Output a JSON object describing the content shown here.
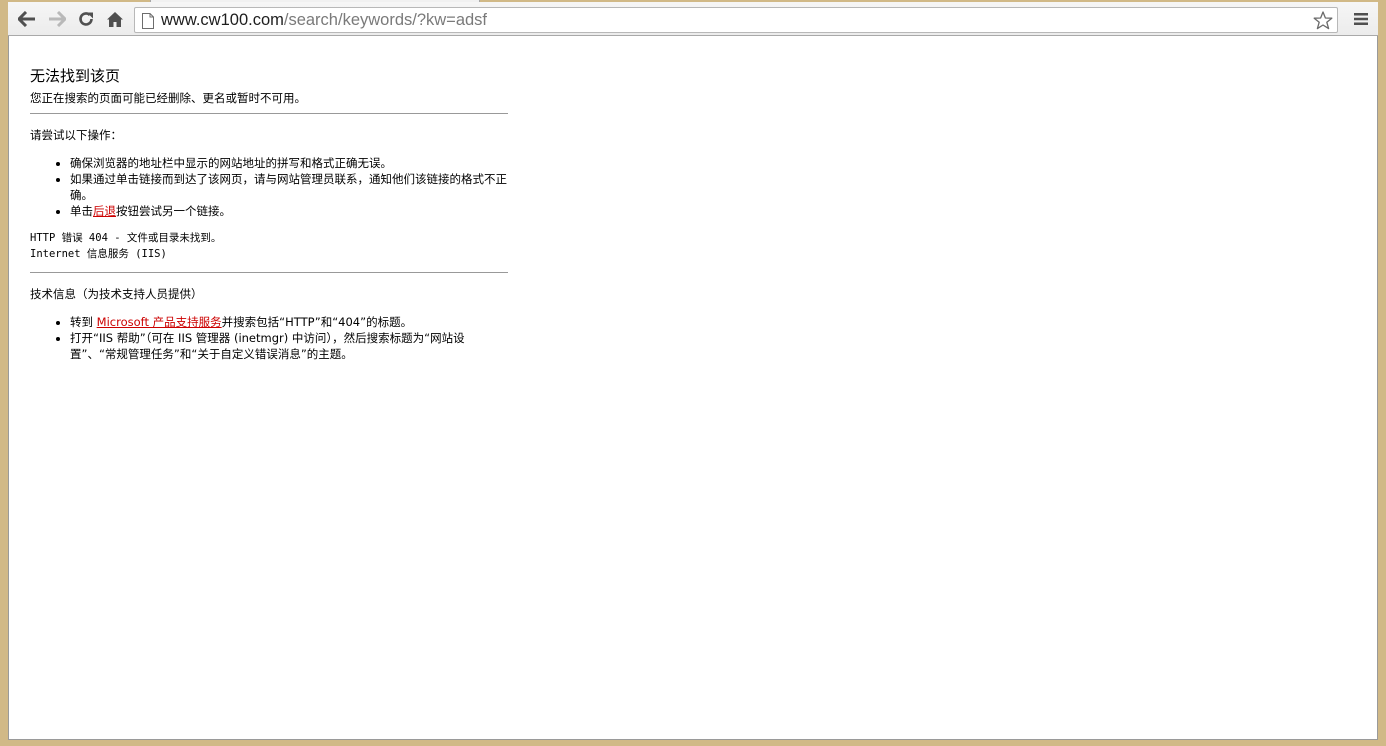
{
  "browser": {
    "url_host": "www.cw100.com",
    "url_path": "/search/keywords/?kw=adsf",
    "icons": {
      "back": "back-arrow-icon",
      "forward": "forward-arrow-icon",
      "reload": "reload-icon",
      "home": "home-icon",
      "page": "page-icon",
      "star": "star-icon",
      "menu": "hamburger-menu-icon"
    }
  },
  "error_page": {
    "title": "无法找到该页",
    "subtitle": "您正在搜索的页面可能已经删除、更名或暂时不可用。",
    "try_heading": "请尝试以下操作：",
    "try_items": [
      {
        "text": "确保浏览器的地址栏中显示的网站地址的拼写和格式正确无误。"
      },
      {
        "text": "如果通过单击链接而到达了该网页，请与网站管理员联系，通知他们该链接的格式不正确。"
      },
      {
        "before": "单击",
        "link": "后退",
        "after": "按钮尝试另一个链接。"
      }
    ],
    "http_error": "HTTP 错误 404 - 文件或目录未找到。",
    "server": "Internet 信息服务 (IIS)",
    "tech_heading": "技术信息（为技术支持人员提供）",
    "tech_items": [
      {
        "before": "转到 ",
        "link": "Microsoft 产品支持服务",
        "after": "并搜索包括“HTTP”和“404”的标题。"
      },
      {
        "text": "打开“IIS 帮助”（可在 IIS 管理器 (inetmgr) 中访问），然后搜索标题为“网站设置”、“常规管理任务”和“关于自定义错误消息”的主题。"
      }
    ],
    "link_color": "#cc0000"
  }
}
